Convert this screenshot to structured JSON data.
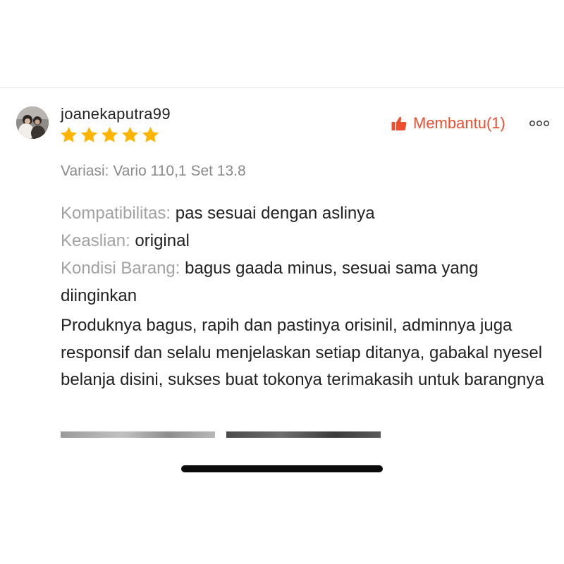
{
  "review": {
    "username": "joanekaputra99",
    "rating": 5,
    "helpful_label": "Membantu(1)",
    "variation_label": "Variasi:",
    "variation_value": "Vario 110,1 Set 13.8",
    "attributes": [
      {
        "key": "Kompatibilitas:",
        "value": "pas sesuai dengan aslinya"
      },
      {
        "key": "Keaslian:",
        "value": "original"
      },
      {
        "key": "Kondisi Barang:",
        "value": "bagus gaada minus, sesuai sama yang diinginkan"
      }
    ],
    "body": "Produknya bagus, rapih dan pastinya orisinil, adminnya juga responsif dan selalu menjelaskan setiap ditanya, gabakal nyesel belanja disini, sukses buat tokonya terimakasih untuk barangnya"
  },
  "icons": {
    "helpful": "thumbs-up-icon",
    "more": "more-options-icon",
    "star": "star-icon"
  },
  "colors": {
    "accent": "#ee4d2d",
    "star": "#ffb400",
    "label_gray": "#a2a2a2"
  }
}
